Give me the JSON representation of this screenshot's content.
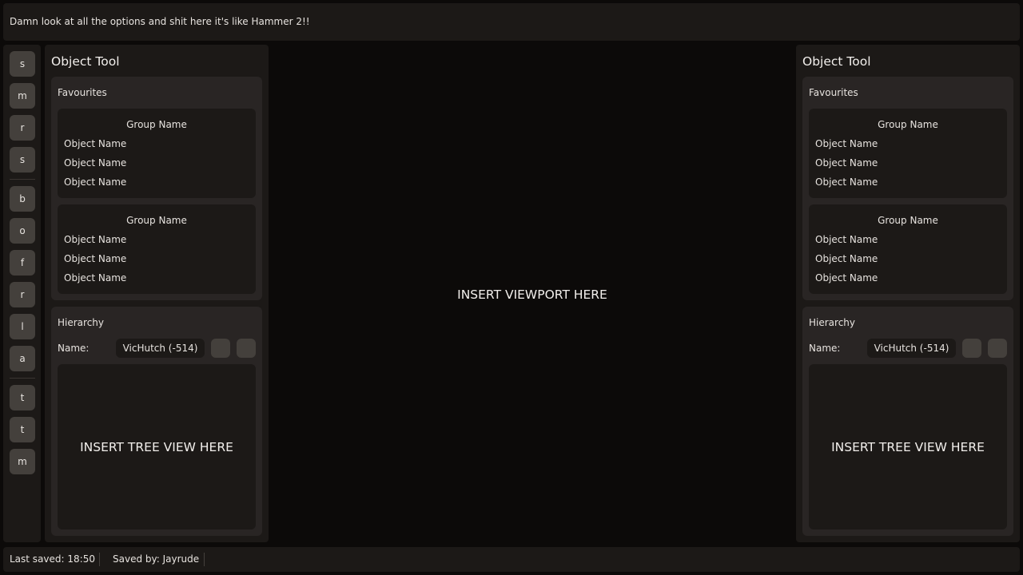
{
  "topbar": {
    "text": "Damn look at all the options and shit here it's like Hammer 2!!"
  },
  "toolbar": {
    "buttons": [
      "s",
      "m",
      "r",
      "s",
      "b",
      "o",
      "f",
      "r",
      "l",
      "a",
      "t",
      "t",
      "m"
    ]
  },
  "viewport": {
    "placeholder": "INSERT VIEWPORT HERE"
  },
  "panels": [
    {
      "title": "Object Tool",
      "favourites": {
        "title": "Favourites",
        "groups": [
          {
            "name": "Group Name",
            "objects": [
              "Object Name",
              "Object Name",
              "Object Name"
            ]
          },
          {
            "name": "Group Name",
            "objects": [
              "Object Name",
              "Object Name",
              "Object Name"
            ]
          }
        ]
      },
      "hierarchy": {
        "title": "Hierarchy",
        "name_label": "Name:",
        "name_value": "VicHutch (-514)",
        "tree_placeholder": "INSERT TREE VIEW HERE"
      }
    },
    {
      "title": "Object Tool",
      "favourites": {
        "title": "Favourites",
        "groups": [
          {
            "name": "Group Name",
            "objects": [
              "Object Name",
              "Object Name",
              "Object Name"
            ]
          },
          {
            "name": "Group Name",
            "objects": [
              "Object Name",
              "Object Name",
              "Object Name"
            ]
          }
        ]
      },
      "hierarchy": {
        "title": "Hierarchy",
        "name_label": "Name:",
        "name_value": "VicHutch (-514)",
        "tree_placeholder": "INSERT TREE VIEW HERE"
      }
    }
  ],
  "status": {
    "last_saved": "Last saved: 18:50",
    "saved_by": "Saved by: Jayrude"
  },
  "colors": {
    "background": "#0c0a09",
    "panel": "#1c1917",
    "section": "#292524",
    "button": "#44403c",
    "text": "#e7e3df"
  }
}
